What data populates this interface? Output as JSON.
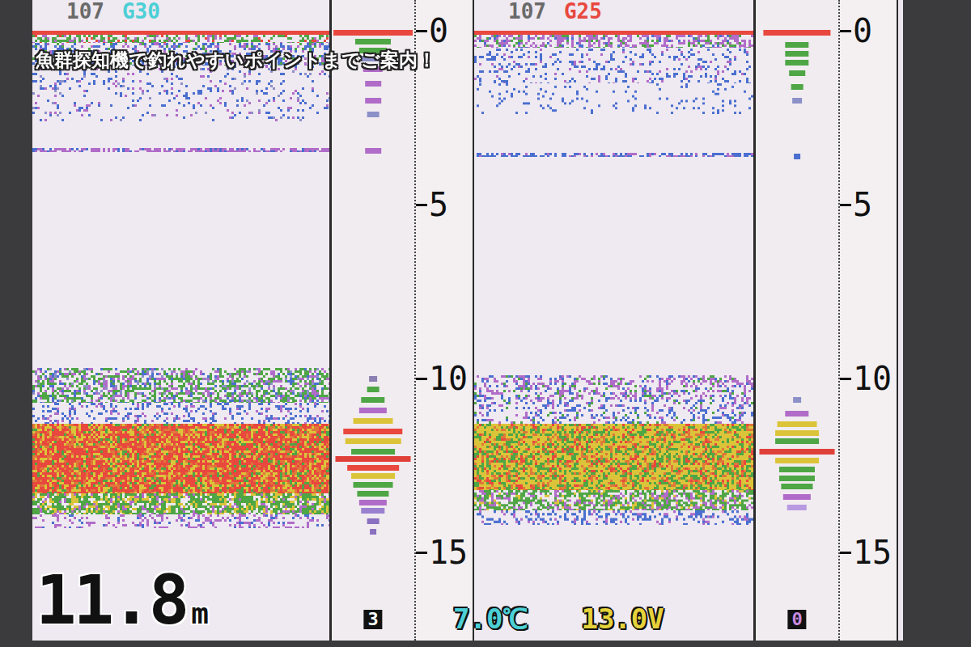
{
  "caption": "魚群探知機で釣れやすいポイントまでご案内！",
  "panels": [
    {
      "channel": "107",
      "gain": "G30",
      "color": "#4ccfd6",
      "scale_ticks": [
        {
          "label": "0",
          "value": 0
        },
        {
          "label": "5",
          "value": 5
        },
        {
          "label": "10",
          "value": 10
        },
        {
          "label": "15",
          "value": 15
        }
      ],
      "echo_layers": [
        {
          "from": 0.0,
          "to": 0.12,
          "density": 1,
          "colors": [
            "#e8483e"
          ]
        },
        {
          "from": 0.12,
          "to": 0.35,
          "density": 0.5,
          "colors": [
            "#4ea645",
            "#b06cc8",
            "#e8483e"
          ]
        },
        {
          "from": 0.35,
          "to": 1.0,
          "density": 0.4,
          "colors": [
            "#4a6fd0",
            "#b06cc8",
            "#4ea645"
          ]
        },
        {
          "from": 1.0,
          "to": 2.6,
          "density": 0.12,
          "colors": [
            "#4a6fd0",
            "#b06cc8",
            "#8c90c8"
          ]
        },
        {
          "from": 3.38,
          "to": 3.5,
          "density": 0.7,
          "colors": [
            "#b06cc8",
            "#4a6fd0"
          ]
        },
        {
          "from": 9.7,
          "to": 10.7,
          "density": 0.55,
          "colors": [
            "#4ea645",
            "#b06cc8",
            "#4a6fd0",
            "#8c90c8"
          ]
        },
        {
          "from": 10.7,
          "to": 11.3,
          "density": 0.25,
          "colors": [
            "#4a6fd0",
            "#b06cc8"
          ]
        },
        {
          "from": 11.3,
          "to": 13.3,
          "density": 1,
          "colors": [
            "#e8483e",
            "#dcc43a",
            "#e0783a",
            "#4ea645"
          ]
        },
        {
          "from": 13.3,
          "to": 13.9,
          "density": 0.8,
          "colors": [
            "#4ea645",
            "#dcc43a",
            "#b06cc8"
          ]
        },
        {
          "from": 13.9,
          "to": 14.3,
          "density": 0.3,
          "colors": [
            "#b06cc8",
            "#4a6fd0"
          ]
        }
      ],
      "strip_bars": [
        {
          "depth": 0.05,
          "level": 1,
          "color": "#e8483e"
        },
        {
          "depth": 0.3,
          "level": 0.45,
          "color": "#4ea645"
        },
        {
          "depth": 0.55,
          "level": 0.35,
          "color": "#4ea645"
        },
        {
          "depth": 0.8,
          "level": 0.3,
          "color": "#8c90c8"
        },
        {
          "depth": 1.1,
          "level": 0.25,
          "color": "#b06cc8"
        },
        {
          "depth": 1.5,
          "level": 0.2,
          "color": "#b06cc8"
        },
        {
          "depth": 2.0,
          "level": 0.2,
          "color": "#b06cc8"
        },
        {
          "depth": 2.4,
          "level": 0.15,
          "color": "#8c90c8"
        },
        {
          "depth": 3.45,
          "level": 0.2,
          "color": "#b06cc8"
        },
        {
          "depth": 10.0,
          "level": 0.1,
          "color": "#8a7fb0"
        },
        {
          "depth": 10.3,
          "level": 0.15,
          "color": "#4ea645"
        },
        {
          "depth": 10.6,
          "level": 0.3,
          "color": "#4ea645"
        },
        {
          "depth": 10.9,
          "level": 0.35,
          "color": "#b06cc8"
        },
        {
          "depth": 11.2,
          "level": 0.5,
          "color": "#dcc43a"
        },
        {
          "depth": 11.5,
          "level": 0.75,
          "color": "#e8483e"
        },
        {
          "depth": 11.8,
          "level": 0.7,
          "color": "#dcc43a"
        },
        {
          "depth": 12.1,
          "level": 0.55,
          "color": "#4ea645"
        },
        {
          "depth": 12.3,
          "level": 0.95,
          "color": "#e0403a"
        },
        {
          "depth": 12.55,
          "level": 0.65,
          "color": "#e8483e"
        },
        {
          "depth": 12.8,
          "level": 0.55,
          "color": "#dcc43a"
        },
        {
          "depth": 13.05,
          "level": 0.5,
          "color": "#4ea645"
        },
        {
          "depth": 13.3,
          "level": 0.4,
          "color": "#4ea645"
        },
        {
          "depth": 13.55,
          "level": 0.35,
          "color": "#b06cc8"
        },
        {
          "depth": 13.8,
          "level": 0.3,
          "color": "#9a80d0"
        },
        {
          "depth": 14.1,
          "level": 0.15,
          "color": "#8a70c0"
        },
        {
          "depth": 14.4,
          "level": 0.08,
          "color": "#8a70c0"
        }
      ],
      "counter": "3",
      "counter_color": "#ffffff"
    },
    {
      "channel": "107",
      "gain": "G25",
      "color": "#e8483e",
      "scale_ticks": [
        {
          "label": "0",
          "value": 0
        },
        {
          "label": "5",
          "value": 5
        },
        {
          "label": "10",
          "value": 10
        },
        {
          "label": "15",
          "value": 15
        }
      ],
      "echo_layers": [
        {
          "from": 0.0,
          "to": 0.12,
          "density": 1,
          "colors": [
            "#e8483e"
          ]
        },
        {
          "from": 0.12,
          "to": 0.5,
          "density": 0.5,
          "colors": [
            "#b06cc8",
            "#4ea645",
            "#4a6fd0"
          ]
        },
        {
          "from": 0.5,
          "to": 1.5,
          "density": 0.2,
          "colors": [
            "#4a6fd0",
            "#b06cc8"
          ]
        },
        {
          "from": 1.5,
          "to": 2.4,
          "density": 0.08,
          "colors": [
            "#4a6fd0"
          ]
        },
        {
          "from": 3.5,
          "to": 3.62,
          "density": 0.6,
          "colors": [
            "#4a6fd0",
            "#b06cc8"
          ]
        },
        {
          "from": 9.9,
          "to": 10.6,
          "density": 0.4,
          "colors": [
            "#b06cc8",
            "#4a6fd0",
            "#4ea645"
          ]
        },
        {
          "from": 10.6,
          "to": 11.3,
          "density": 0.3,
          "colors": [
            "#4a6fd0",
            "#b06cc8",
            "#4ea645"
          ]
        },
        {
          "from": 11.3,
          "to": 13.2,
          "density": 1,
          "colors": [
            "#dcc43a",
            "#4ea645",
            "#e0783a",
            "#e8483e"
          ]
        },
        {
          "from": 13.2,
          "to": 13.8,
          "density": 0.7,
          "colors": [
            "#4ea645",
            "#b06cc8",
            "#dcc43a"
          ]
        },
        {
          "from": 13.8,
          "to": 14.2,
          "density": 0.3,
          "colors": [
            "#4a6fd0",
            "#b06cc8"
          ]
        }
      ],
      "strip_bars": [
        {
          "depth": 0.05,
          "level": 0.85,
          "color": "#e8483e"
        },
        {
          "depth": 0.4,
          "level": 0.3,
          "color": "#4ea645"
        },
        {
          "depth": 0.65,
          "level": 0.3,
          "color": "#4ea645"
        },
        {
          "depth": 0.9,
          "level": 0.3,
          "color": "#4ea645"
        },
        {
          "depth": 1.2,
          "level": 0.2,
          "color": "#4ea645"
        },
        {
          "depth": 1.6,
          "level": 0.15,
          "color": "#4ea645"
        },
        {
          "depth": 2.0,
          "level": 0.12,
          "color": "#8c90c8"
        },
        {
          "depth": 3.6,
          "level": 0.08,
          "color": "#4a6fd0"
        },
        {
          "depth": 10.6,
          "level": 0.1,
          "color": "#8c90c8"
        },
        {
          "depth": 11.0,
          "level": 0.3,
          "color": "#b06cc8"
        },
        {
          "depth": 11.3,
          "level": 0.5,
          "color": "#dcc43a"
        },
        {
          "depth": 11.55,
          "level": 0.55,
          "color": "#dcc43a"
        },
        {
          "depth": 11.8,
          "level": 0.55,
          "color": "#4ea645"
        },
        {
          "depth": 12.1,
          "level": 0.95,
          "color": "#e0403a"
        },
        {
          "depth": 12.35,
          "level": 0.55,
          "color": "#dcc43a"
        },
        {
          "depth": 12.6,
          "level": 0.45,
          "color": "#4ea645"
        },
        {
          "depth": 12.85,
          "level": 0.45,
          "color": "#4ea645"
        },
        {
          "depth": 13.1,
          "level": 0.4,
          "color": "#4ea645"
        },
        {
          "depth": 13.4,
          "level": 0.35,
          "color": "#b06cc8"
        },
        {
          "depth": 13.7,
          "level": 0.25,
          "color": "#b89ae0"
        }
      ],
      "counter": "0",
      "counter_color": "#c88ae0"
    }
  ],
  "readouts": {
    "depth": "11.8",
    "depth_unit": "m",
    "water_temp": "7.0℃",
    "water_temp_color": "#4ccfd6",
    "voltage": "13.0V",
    "voltage_color": "#e6d23a"
  }
}
